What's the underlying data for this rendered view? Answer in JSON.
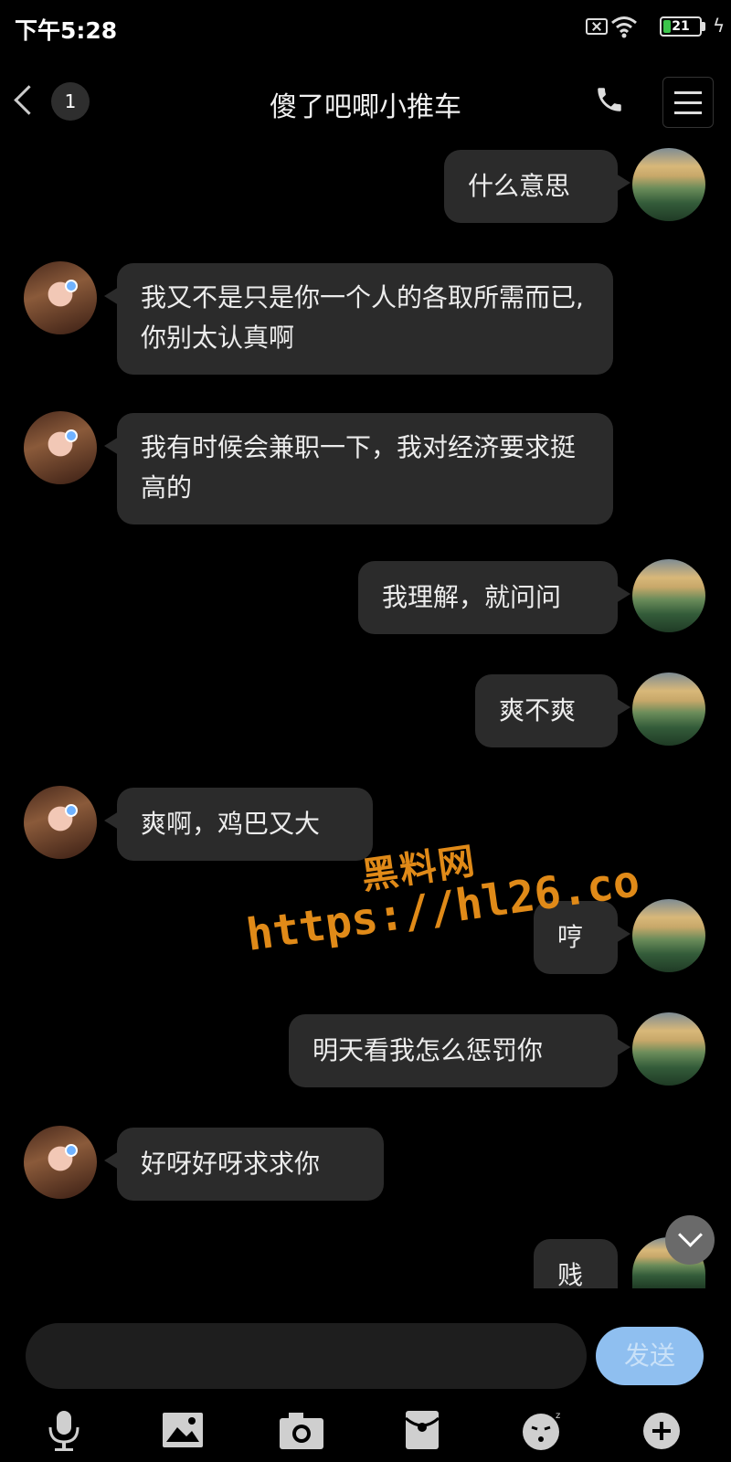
{
  "status_bar": {
    "time": "下午5:28",
    "battery": "21",
    "battery_level_percent": 21,
    "icons": [
      "sim-off-icon",
      "wifi-icon",
      "battery-icon",
      "charging-icon"
    ]
  },
  "header": {
    "unread_count": "1",
    "title": "傻了吧唧小推车",
    "icons": [
      "back-icon",
      "phone-icon",
      "menu-icon"
    ]
  },
  "messages": [
    {
      "side": "right",
      "text": "什么意思"
    },
    {
      "side": "left",
      "text": "我又不是只是你一个人的各取所需而已,你别太认真啊"
    },
    {
      "side": "left",
      "text": "我有时候会兼职一下，我对经济要求挺高的"
    },
    {
      "side": "right",
      "text": "我理解，就问问"
    },
    {
      "side": "right",
      "text": "爽不爽"
    },
    {
      "side": "left",
      "text": "爽啊，鸡巴又大"
    },
    {
      "side": "right",
      "text": "哼"
    },
    {
      "side": "right",
      "text": "明天看我怎么惩罚你"
    },
    {
      "side": "left",
      "text": "好呀好呀求求你"
    },
    {
      "side": "right",
      "text": "贱"
    }
  ],
  "watermark": {
    "line1": "黑料网",
    "line2": "https://hl26.co"
  },
  "composer": {
    "input_value": "",
    "send_label": "发送",
    "toolbar": [
      "microphone-icon",
      "image-icon",
      "camera-icon",
      "red-packet-icon",
      "emoji-icon",
      "plus-icon"
    ]
  },
  "colors": {
    "background": "#000000",
    "bubble": "#2b2b2b",
    "send_button": "#8fbff0",
    "watermark": "#e08a18"
  }
}
